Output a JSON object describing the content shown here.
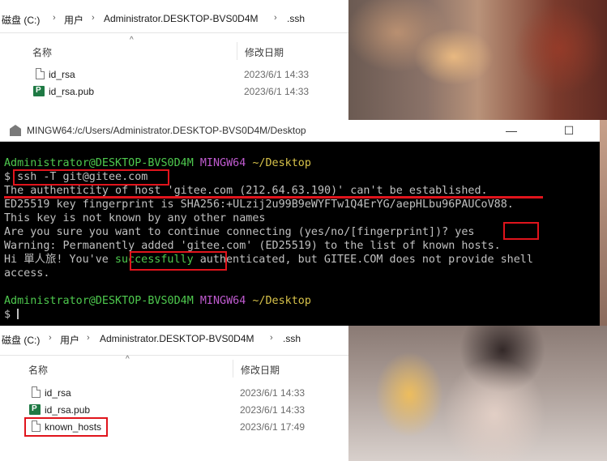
{
  "explorer_top": {
    "breadcrumb": [
      "磁盘 (C:)",
      "用户",
      "Administrator.DESKTOP-BVS0D4M",
      ".ssh"
    ],
    "columns": {
      "name": "名称",
      "modified": "修改日期"
    },
    "files": [
      {
        "name": "id_rsa",
        "date": "2023/6/1 14:33",
        "icon": "file-icon"
      },
      {
        "name": "id_rsa.pub",
        "date": "2023/6/1 14:33",
        "icon": "publisher-file-icon"
      }
    ]
  },
  "terminal": {
    "title": "MINGW64:/c/Users/Administrator.DESKTOP-BVS0D4M/Desktop",
    "controls": {
      "minimize": "—",
      "maximize": "☐",
      "close": "✕"
    },
    "prompt1": {
      "user": "Administrator@DESKTOP-BVS0D4M",
      "env": "MINGW64",
      "path": "~/Desktop"
    },
    "command": "$ ssh -T git@gitee.com",
    "output": [
      "The authenticity of host 'gitee.com (212.64.63.190)' can't be established.",
      "ED25519 key fingerprint is SHA256:+ULzij2u99B9eWYFTw1Q4ErYG/aepHLbu96PAUCoV88.",
      "This key is not known by any other names",
      "Are you sure you want to continue connecting (yes/no/[fingerprint])? yes",
      "Warning: Permanently added 'gitee.com' (ED25519) to the list of known hosts."
    ],
    "hi_line": {
      "prefix": "Hi ",
      "name": "單人旅",
      "mid": "! You've ",
      "success": "successfully",
      "rest": " authenticated, but GITEE.COM does not provide shell"
    },
    "access_line": "access.",
    "prompt2": {
      "user": "Administrator@DESKTOP-BVS0D4M",
      "env": "MINGW64",
      "path": "~/Desktop"
    },
    "final_prompt": "$"
  },
  "explorer_bottom": {
    "breadcrumb": [
      "磁盘 (C:)",
      "用户",
      "Administrator.DESKTOP-BVS0D4M",
      ".ssh"
    ],
    "columns": {
      "name": "名称",
      "modified": "修改日期"
    },
    "files": [
      {
        "name": "id_rsa",
        "date": "2023/6/1 14:33",
        "icon": "file-icon"
      },
      {
        "name": "id_rsa.pub",
        "date": "2023/6/1 14:33",
        "icon": "publisher-file-icon"
      },
      {
        "name": "known_hosts",
        "date": "2023/6/1 17:49",
        "icon": "file-icon"
      }
    ]
  },
  "colors": {
    "highlight": "#e0141c",
    "prompt_green": "#4ec94e",
    "prompt_purple": "#c05bd0",
    "path_yellow": "#d7c24a"
  }
}
